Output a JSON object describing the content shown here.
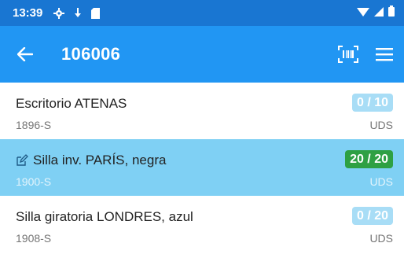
{
  "status_bar": {
    "time": "13:39"
  },
  "app_bar": {
    "title": "106006"
  },
  "items": [
    {
      "name": "Escritorio ATENAS",
      "code": "1896-S",
      "count": "0 / 10",
      "unit": "UDS"
    },
    {
      "name": "Silla inv. PARÍS, negra",
      "code": "1900-S",
      "count": "20 / 20",
      "unit": "UDS"
    },
    {
      "name": "Silla giratoria LONDRES, azul",
      "code": "1908-S",
      "count": "0 / 20",
      "unit": "UDS"
    }
  ],
  "colors": {
    "statusbar": "#1976D2",
    "appbar": "#2196F3",
    "selected_row": "#7FD0F4",
    "badge_pending": "#A8DDF6",
    "badge_done": "#2EA043"
  }
}
